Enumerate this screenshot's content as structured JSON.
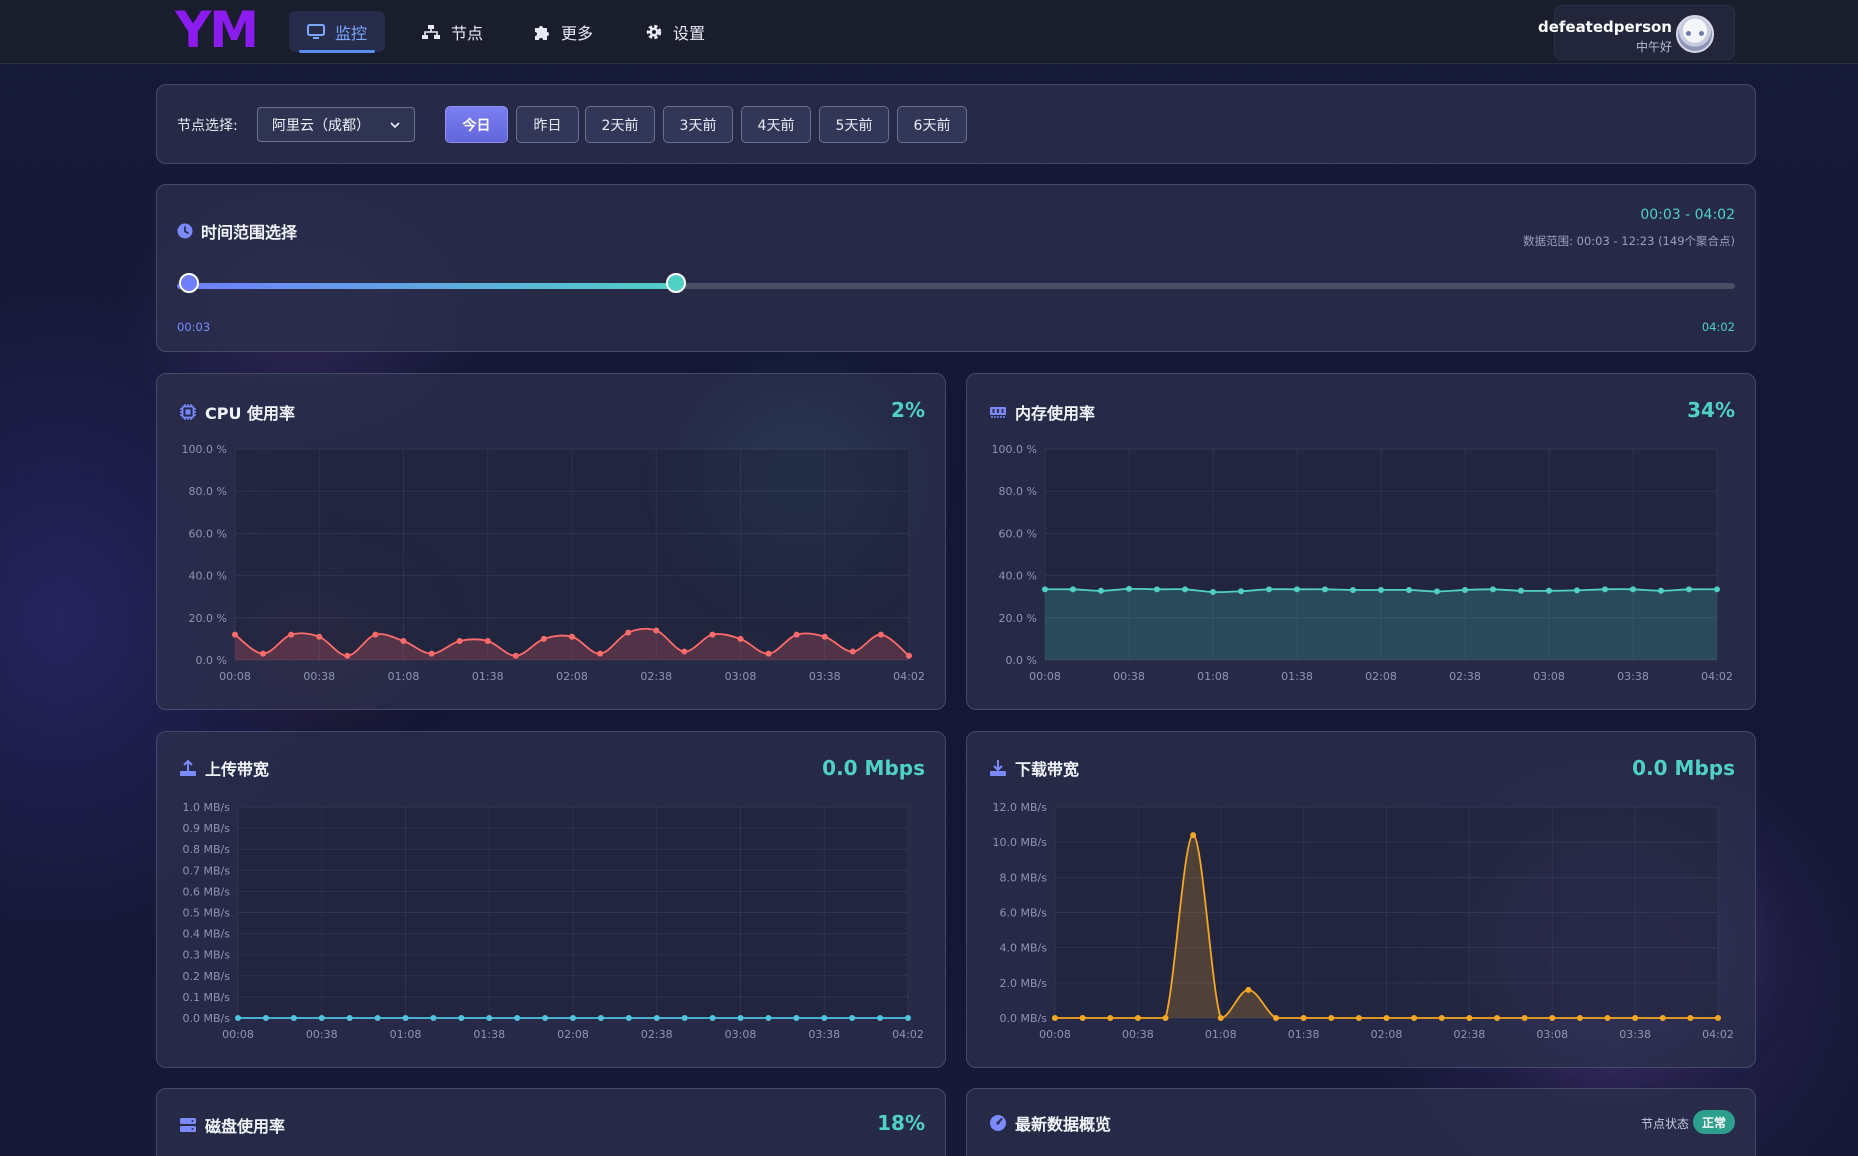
{
  "nav": {
    "logo": "YM",
    "items": [
      {
        "label": "监控",
        "icon": "monitor-icon",
        "active": true
      },
      {
        "label": "节点",
        "icon": "network-icon",
        "active": false
      },
      {
        "label": "更多",
        "icon": "puzzle-icon",
        "active": false
      },
      {
        "label": "设置",
        "icon": "gear-icon",
        "active": false
      }
    ],
    "user": {
      "name": "defeatedperson",
      "greeting": "中午好"
    }
  },
  "filter": {
    "label": "节点选择:",
    "node_selected": "阿里云（成都）",
    "days": [
      "今日",
      "昨日",
      "2天前",
      "3天前",
      "4天前",
      "5天前",
      "6天前"
    ],
    "active_day": "今日"
  },
  "time_range": {
    "title": "时间范围选择",
    "selected": "00:03 - 04:02",
    "data_range": "数据范围: 00:03 - 12:23 (149个聚合点)",
    "start_label": "00:03",
    "end_label": "04:02",
    "end_position_fraction": 0.32
  },
  "panels": {
    "cpu": {
      "title": "CPU 使用率",
      "value": "2%",
      "icon": "cpu-icon"
    },
    "memory": {
      "title": "内存使用率",
      "value": "34%",
      "icon": "memory-icon"
    },
    "upload": {
      "title": "上传带宽",
      "value": "0.0 Mbps",
      "icon": "upload-icon"
    },
    "download": {
      "title": "下载带宽",
      "value": "0.0 Mbps",
      "icon": "download-icon"
    },
    "disk": {
      "title": "磁盘使用率",
      "value": "18%",
      "icon": "disk-icon"
    },
    "overview": {
      "title": "最新数据概览",
      "icon": "gauge-icon",
      "status_label": "节点状态",
      "status": "正常"
    }
  },
  "colors": {
    "accent": "#4fd1c5",
    "cpu": "#ff6b6b",
    "memory": "#4fd1c5",
    "upload": "#4fc3e0",
    "download": "#f5a623",
    "brand": "#8c1bf0"
  },
  "chart_data": [
    {
      "id": "cpu",
      "type": "line",
      "x_ticks": [
        "00:08",
        "00:38",
        "01:08",
        "01:38",
        "02:08",
        "02:38",
        "03:08",
        "03:38",
        "04:02"
      ],
      "y_ticks": [
        "0.0 %",
        "20.0 %",
        "40.0 %",
        "60.0 %",
        "80.0 %",
        "100.0 %"
      ],
      "ylim": [
        0,
        100
      ],
      "color": "#ff6b6b",
      "fill": true,
      "values": [
        12,
        3,
        12,
        11,
        2,
        12,
        9,
        3,
        9,
        9,
        2,
        10,
        11,
        3,
        13,
        14,
        4,
        12,
        10,
        3,
        12,
        11,
        4,
        12,
        2
      ]
    },
    {
      "id": "memory",
      "type": "line",
      "x_ticks": [
        "00:08",
        "00:38",
        "01:08",
        "01:38",
        "02:08",
        "02:38",
        "03:08",
        "03:38",
        "04:02"
      ],
      "y_ticks": [
        "0.0 %",
        "20.0 %",
        "40.0 %",
        "60.0 %",
        "80.0 %",
        "100.0 %"
      ],
      "ylim": [
        0,
        100
      ],
      "color": "#4fd1c5",
      "fill": true,
      "values": [
        33.5,
        33.5,
        32.8,
        33.7,
        33.5,
        33.5,
        32.2,
        32.6,
        33.5,
        33.5,
        33.5,
        33.2,
        33.2,
        33.2,
        32.5,
        33.2,
        33.5,
        32.8,
        32.8,
        33.0,
        33.5,
        33.5,
        32.8,
        33.5,
        33.5
      ]
    },
    {
      "id": "upload",
      "type": "line",
      "x_ticks": [
        "00:08",
        "00:38",
        "01:08",
        "01:38",
        "02:08",
        "02:38",
        "03:08",
        "03:38",
        "04:02"
      ],
      "y_ticks": [
        "0.0 MB/s",
        "0.1 MB/s",
        "0.2 MB/s",
        "0.3 MB/s",
        "0.4 MB/s",
        "0.5 MB/s",
        "0.6 MB/s",
        "0.7 MB/s",
        "0.8 MB/s",
        "0.9 MB/s",
        "1.0 MB/s"
      ],
      "ylim": [
        0,
        1
      ],
      "color": "#4fc3e0",
      "fill": false,
      "values": [
        0,
        0,
        0,
        0,
        0,
        0,
        0,
        0,
        0,
        0,
        0,
        0,
        0,
        0,
        0,
        0,
        0,
        0,
        0,
        0,
        0,
        0,
        0,
        0,
        0
      ]
    },
    {
      "id": "download",
      "type": "line",
      "x_ticks": [
        "00:08",
        "00:38",
        "01:08",
        "01:38",
        "02:08",
        "02:38",
        "03:08",
        "03:38",
        "04:02"
      ],
      "y_ticks": [
        "0.0 MB/s",
        "2.0 MB/s",
        "4.0 MB/s",
        "6.0 MB/s",
        "8.0 MB/s",
        "10.0 MB/s",
        "12.0 MB/s"
      ],
      "ylim": [
        0,
        12
      ],
      "color": "#f5a623",
      "fill": true,
      "values": [
        0,
        0,
        0,
        0,
        0,
        10.4,
        0,
        1.6,
        0,
        0,
        0,
        0,
        0,
        0,
        0,
        0,
        0,
        0,
        0,
        0,
        0,
        0,
        0,
        0,
        0
      ]
    }
  ]
}
